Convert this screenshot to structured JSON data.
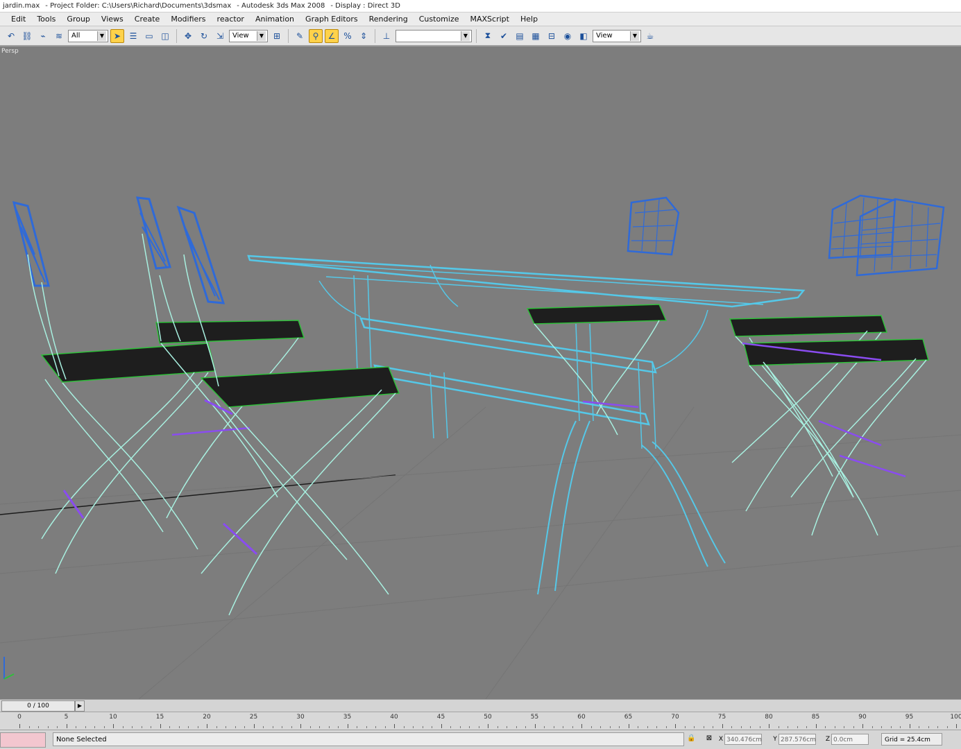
{
  "titlebar": {
    "file": "jardin.max",
    "project": "- Project Folder: C:\\Users\\Richard\\Documents\\3dsmax",
    "app": "- Autodesk 3ds Max 2008",
    "display": "- Display : Direct 3D"
  },
  "menu": [
    "Edit",
    "Tools",
    "Group",
    "Views",
    "Create",
    "Modifiers",
    "reactor",
    "Animation",
    "Graph Editors",
    "Rendering",
    "Customize",
    "MAXScript",
    "Help"
  ],
  "toolbar": {
    "selection_filter": "All",
    "reference_coord": "View",
    "named_selection": "",
    "render_view": "View"
  },
  "viewport": {
    "label": "Persp",
    "colors": {
      "table": "#55c8e8",
      "chair_frame": "#a8f0e0",
      "chair_back": "#2f6ad8",
      "seat": "#1e1e1e",
      "seat_edge": "#2fbf3a",
      "stretcher": "#8a4cf0",
      "grid": "#1b1b1b"
    }
  },
  "timeline": {
    "frame": "0 / 100",
    "ticks": [
      "0",
      "5",
      "10",
      "15",
      "20",
      "25",
      "30",
      "35",
      "40",
      "45",
      "50",
      "55",
      "60",
      "65",
      "70",
      "75",
      "80",
      "85",
      "90",
      "95",
      "100"
    ]
  },
  "status": {
    "selection": "None Selected",
    "x_label": "X",
    "x_value": "340.476cm",
    "y_label": "Y",
    "y_value": "287.576cm",
    "z_label": "Z",
    "z_value": "0.0cm",
    "grid": "Grid = 25.4cm"
  }
}
